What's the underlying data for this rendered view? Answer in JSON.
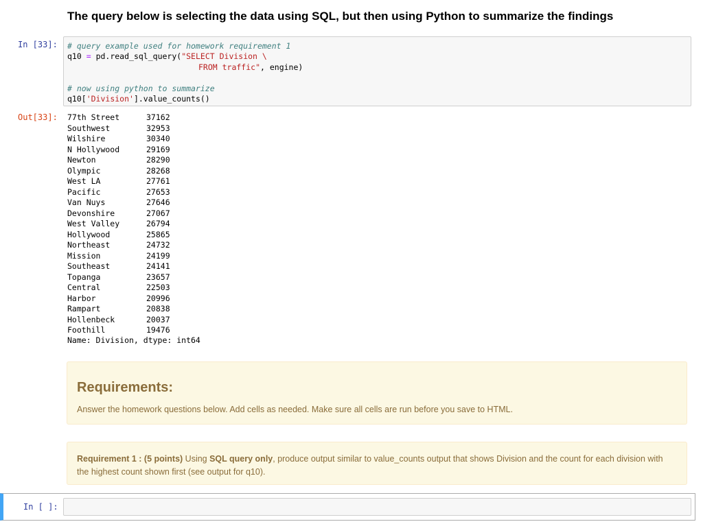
{
  "heading": "The query below is selecting the data using SQL, but then using Python to summarize the findings",
  "cell_33": {
    "in_prompt": "In [33]:",
    "out_prompt": "Out[33]:",
    "code": {
      "line1_comment": "# query example used for homework requirement 1",
      "line2_pre": "q10 ",
      "line2_op": "=",
      "line2_mid": " pd.read_sql_query(",
      "line2_str": "\"SELECT Division \\",
      "line3_str": "FROM traffic\"",
      "line3_post": ", engine)",
      "line5_comment": "# now using python to summarize",
      "line6_pre": "q10[",
      "line6_str": "'Division'",
      "line6_post": "].value_counts()"
    },
    "output_rows": [
      {
        "label": "77th Street",
        "count": "37162"
      },
      {
        "label": "Southwest",
        "count": "32953"
      },
      {
        "label": "Wilshire",
        "count": "30340"
      },
      {
        "label": "N Hollywood",
        "count": "29169"
      },
      {
        "label": "Newton",
        "count": "28290"
      },
      {
        "label": "Olympic",
        "count": "28268"
      },
      {
        "label": "West LA",
        "count": "27761"
      },
      {
        "label": "Pacific",
        "count": "27653"
      },
      {
        "label": "Van Nuys",
        "count": "27646"
      },
      {
        "label": "Devonshire",
        "count": "27067"
      },
      {
        "label": "West Valley",
        "count": "26794"
      },
      {
        "label": "Hollywood",
        "count": "25865"
      },
      {
        "label": "Northeast",
        "count": "24732"
      },
      {
        "label": "Mission",
        "count": "24199"
      },
      {
        "label": "Southeast",
        "count": "24141"
      },
      {
        "label": "Topanga",
        "count": "23657"
      },
      {
        "label": "Central",
        "count": "22503"
      },
      {
        "label": "Harbor",
        "count": "20996"
      },
      {
        "label": "Rampart",
        "count": "20838"
      },
      {
        "label": "Hollenbeck",
        "count": "20037"
      },
      {
        "label": "Foothill",
        "count": "19476"
      }
    ],
    "output_footer": "Name: Division, dtype: int64"
  },
  "requirements": {
    "title": "Requirements:",
    "text": "Answer the homework questions below. Add cells as needed. Make sure all cells are run before you save to HTML."
  },
  "requirement1": {
    "label": "Requirement 1 : (5 points)",
    "text_a": " Using ",
    "bold_b": "SQL query only",
    "text_c": ", produce output similar to value_counts output that shows Division and the count for each division with the highest count shown first (see output for q10)."
  },
  "empty_cell": {
    "in_prompt": "In [ ]:"
  },
  "colors": {
    "in_prompt": "#303f9f",
    "out_prompt": "#d84315",
    "comment": "#408080",
    "string": "#ba2121",
    "alert_bg": "#fcf8e3",
    "alert_text": "#8a6d3b",
    "selected_cell_bar": "#42a5f5"
  }
}
